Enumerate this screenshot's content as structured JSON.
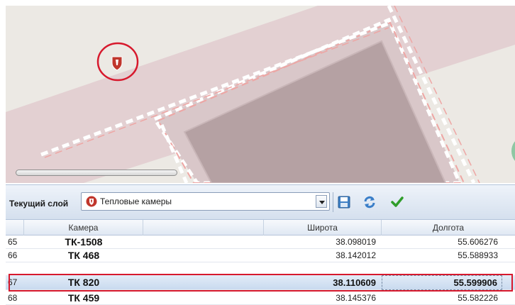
{
  "toolbar": {
    "current_layer_label": "Текущий слой",
    "layer_select_value": "Тепловые камеры"
  },
  "grid": {
    "columns": [
      "Камера",
      "Широта",
      "Долгота"
    ],
    "rows": [
      {
        "idx": "65",
        "camera": "ТК-1508",
        "lat": "38.098019",
        "lon": "55.606276"
      },
      {
        "idx": "66",
        "camera": "ТК 468",
        "lat": "38.142012",
        "lon": "55.588933"
      },
      {
        "idx": "67",
        "camera": "ТК 820",
        "lat": "38.110609",
        "lon": "55.599906"
      },
      {
        "idx": "68",
        "camera": "ТК 459",
        "lat": "38.145376",
        "lon": "55.582226"
      }
    ],
    "selected_row": "67"
  },
  "colors": {
    "highlight": "#d7192d",
    "marker": "#c0362c",
    "map_background": "#ece9e4",
    "building": "#b5a1a3"
  },
  "icons": {
    "map_marker": "thermal-camera-marker-icon",
    "layer": "thermal-camera-icon",
    "save": "save-disk-icon",
    "refresh": "refresh-icon",
    "confirm": "checkmark-icon"
  }
}
